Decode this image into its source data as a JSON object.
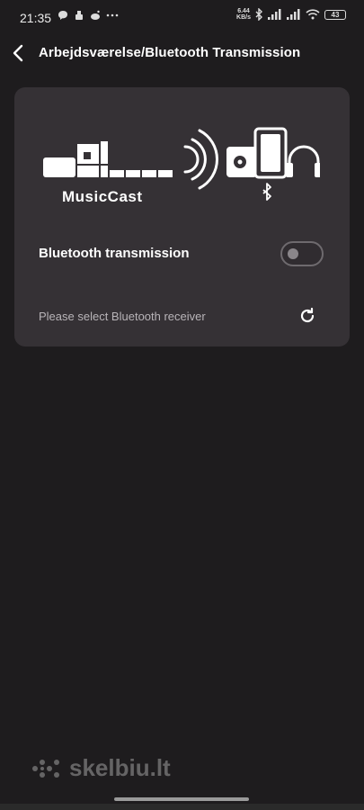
{
  "status_bar": {
    "time": "21:35",
    "net_speed_value": "6.44",
    "net_speed_unit": "KB/s",
    "battery": "43"
  },
  "header": {
    "title": "Arbejdsværelse/Bluetooth Transmission"
  },
  "card": {
    "brand": "MusicCast",
    "bluetooth_transmission_label": "Bluetooth transmission",
    "bluetooth_transmission_enabled": false,
    "receiver_prompt": "Please select Bluetooth receiver"
  },
  "watermark": {
    "text": "skelbiu.lt"
  },
  "colors": {
    "background": "#1e1c1e",
    "card": "#353135",
    "text_primary": "#ffffff",
    "text_secondary": "#b8b4b8",
    "toggle_off": "#8a868a"
  }
}
